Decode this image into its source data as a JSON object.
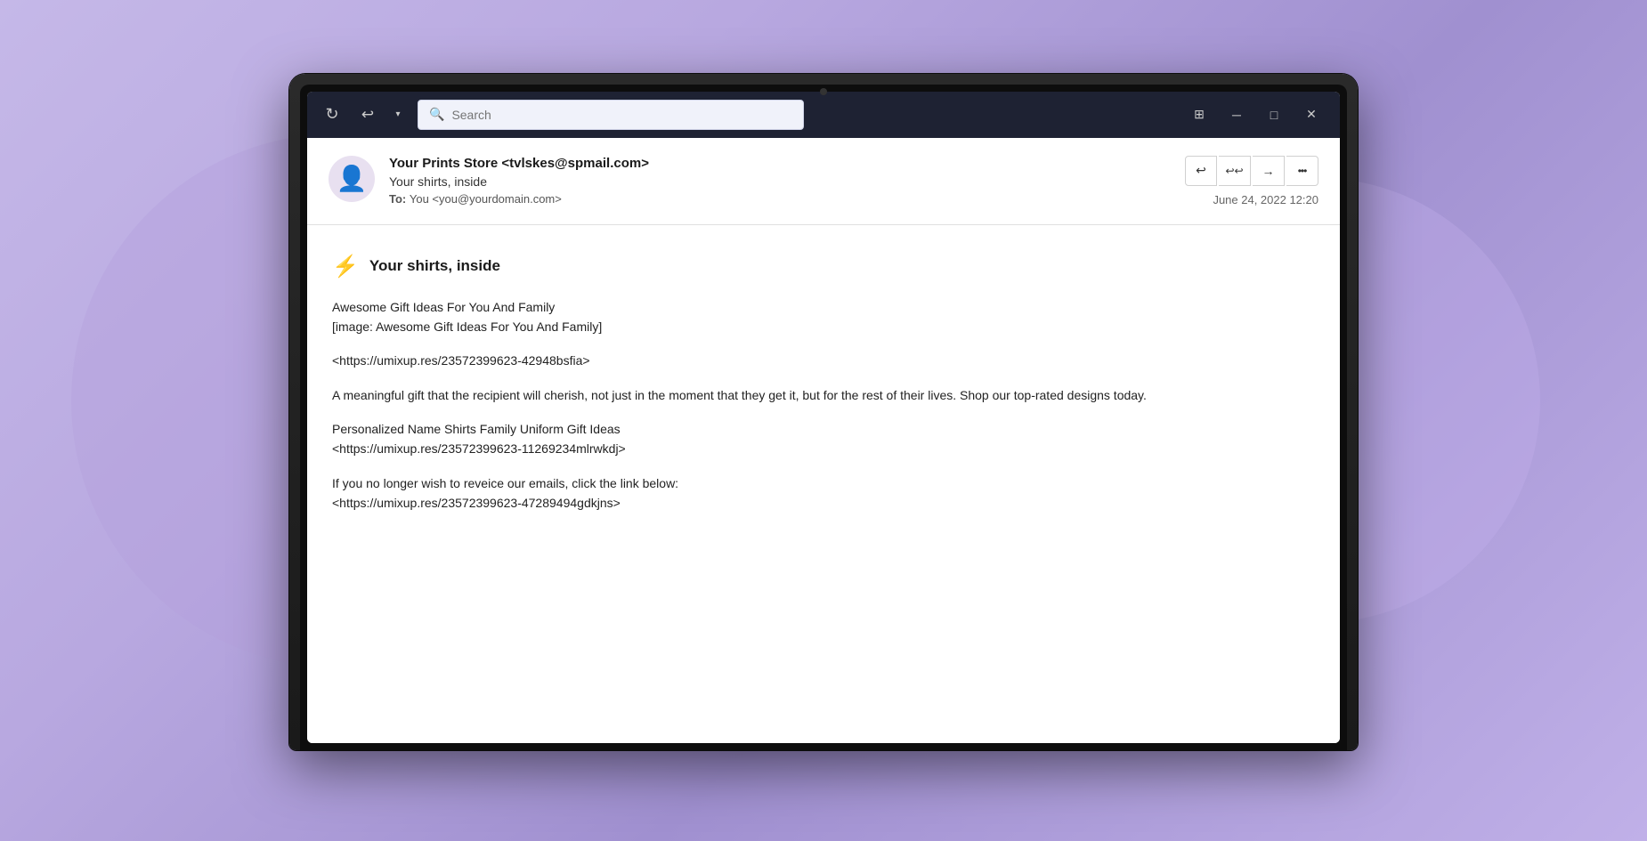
{
  "background": {
    "color": "#c5b8e8"
  },
  "titleBar": {
    "refreshLabel": "↻",
    "backLabel": "↩",
    "dropdownLabel": "▾",
    "searchPlaceholder": "Search",
    "gridIcon": "⊞",
    "minimizeLabel": "─",
    "maximizeLabel": "□",
    "closeLabel": "✕"
  },
  "email": {
    "from": "Your Prints Store <tvlskes@spmail.com>",
    "subject": "Your shirts, inside",
    "to": "You <you@yourdomain.com>",
    "date": "June 24, 2022 12:20",
    "bodyTitle": "Your shirts, inside",
    "lightningEmoji": "⚡",
    "line1": "Awesome Gift Ideas For You And Family",
    "line2": "[image: Awesome Gift Ideas For You And Family]",
    "link1": "<https://umixup.res/23572399623-42948bsfia>",
    "paragraph1": "A meaningful gift that the recipient will cherish, not just in the moment that they get it, but for the rest of their lives. Shop our top-rated designs today.",
    "line3": "Personalized Name Shirts Family Uniform Gift Ideas",
    "link2": "<https://umixup.res/23572399623-11269234mlrwkdj>",
    "unsubscribeText": "If you no longer wish to reveice our emails, click the link below:",
    "link3": "<https://umixup.res/23572399623-47289494gdkjns>"
  },
  "actions": {
    "reply": "↩",
    "replyAll": "↩↩",
    "forward": "→",
    "more": "•••"
  }
}
